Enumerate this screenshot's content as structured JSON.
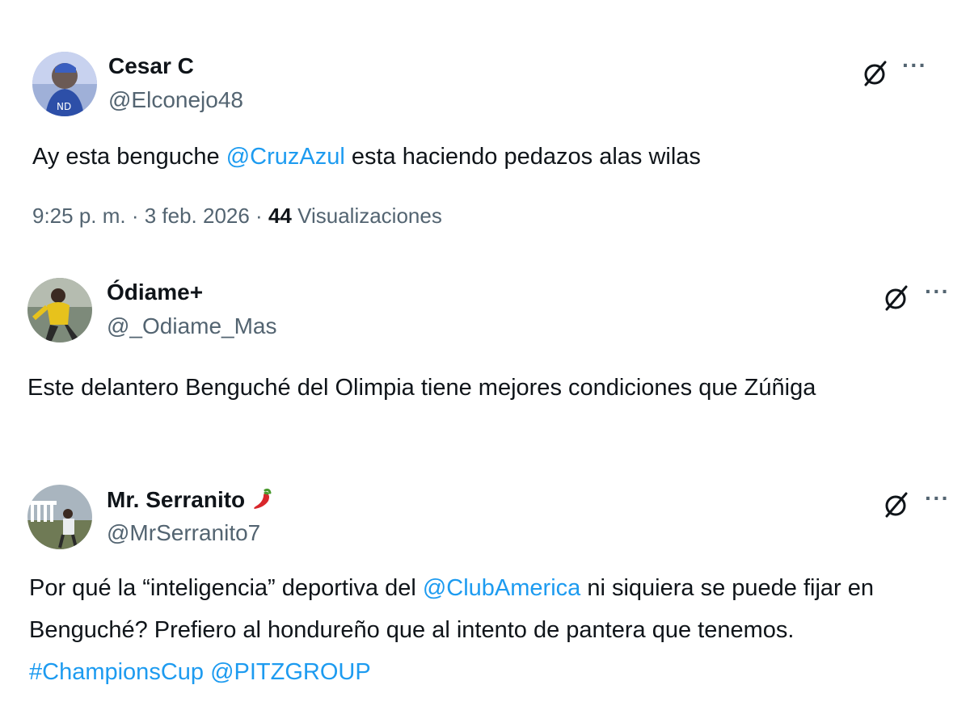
{
  "tweets": [
    {
      "name": "Cesar C",
      "handle": "@Elconejo48",
      "text": [
        {
          "t": "Ay esta benguche ",
          "link": false
        },
        {
          "t": "@CruzAzul",
          "link": true
        },
        {
          "t": " esta haciendo pedazos alas wilas",
          "link": false
        }
      ],
      "time": "9:25 p. m. · 3 feb. 2026 · ",
      "views_count": "44",
      "views_label": " Visualizaciones",
      "icons": {
        "grok": "grok-icon",
        "more": "more-options-icon",
        "avatar": "avatar"
      }
    },
    {
      "name": "Ódiame+",
      "handle": "@_Odiame_Mas",
      "text": [
        {
          "t": "Este delantero Benguché del Olimpia tiene mejores condiciones que Zúñiga",
          "link": false
        }
      ],
      "icons": {
        "grok": "grok-icon",
        "more": "more-options-icon",
        "avatar": "avatar"
      }
    },
    {
      "name": "Mr. Serranito",
      "name_emoji": "hot-pepper-emoji",
      "handle": "@MrSerranito7",
      "text": [
        {
          "t": "Por qué la “inteligencia” deportiva del ",
          "link": false
        },
        {
          "t": "@ClubAmerica",
          "link": true
        },
        {
          "t": " ni siquiera se puede fijar en Benguché? Prefiero al hondureño que al intento de pantera que tenemos. ",
          "link": false
        },
        {
          "t": "#ChampionsCup",
          "link": true
        },
        {
          "t": " ",
          "link": false
        },
        {
          "t": "@PITZGROUP",
          "link": true
        }
      ],
      "icons": {
        "grok": "grok-icon",
        "more": "more-options-icon",
        "avatar": "avatar"
      }
    }
  ],
  "more_glyph": "···",
  "colors": {
    "text": "#0f1419",
    "secondary": "#536471",
    "link": "#1d9bf0",
    "background": "#ffffff"
  }
}
